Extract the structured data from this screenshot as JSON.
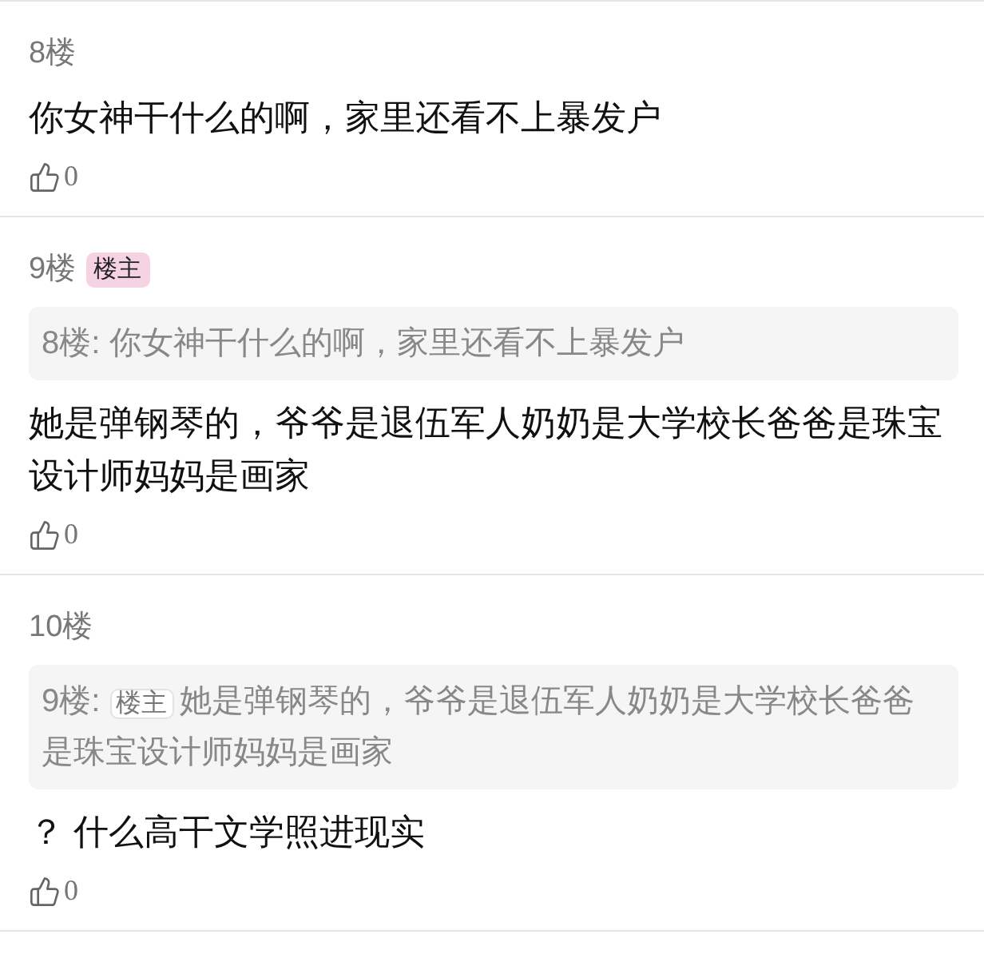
{
  "posts": [
    {
      "floor": "8楼",
      "text": "你女神干什么的啊，家里还看不上暴发户",
      "likes": "0"
    },
    {
      "floor": "9楼",
      "badge": "楼主",
      "quote": {
        "floor": "8楼:",
        "text": "你女神干什么的啊，家里还看不上暴发户"
      },
      "text": "她是弹钢琴的，爷爷是退伍军人奶奶是大学校长爸爸是珠宝设计师妈妈是画家",
      "likes": "0"
    },
    {
      "floor": "10楼",
      "quote": {
        "floor": "9楼:",
        "badge": "楼主",
        "text": "她是弹钢琴的，爷爷是退伍军人奶奶是大学校长爸爸是珠宝设计师妈妈是画家"
      },
      "text": "？ 什么高干文学照进现实",
      "likes": "0"
    }
  ]
}
